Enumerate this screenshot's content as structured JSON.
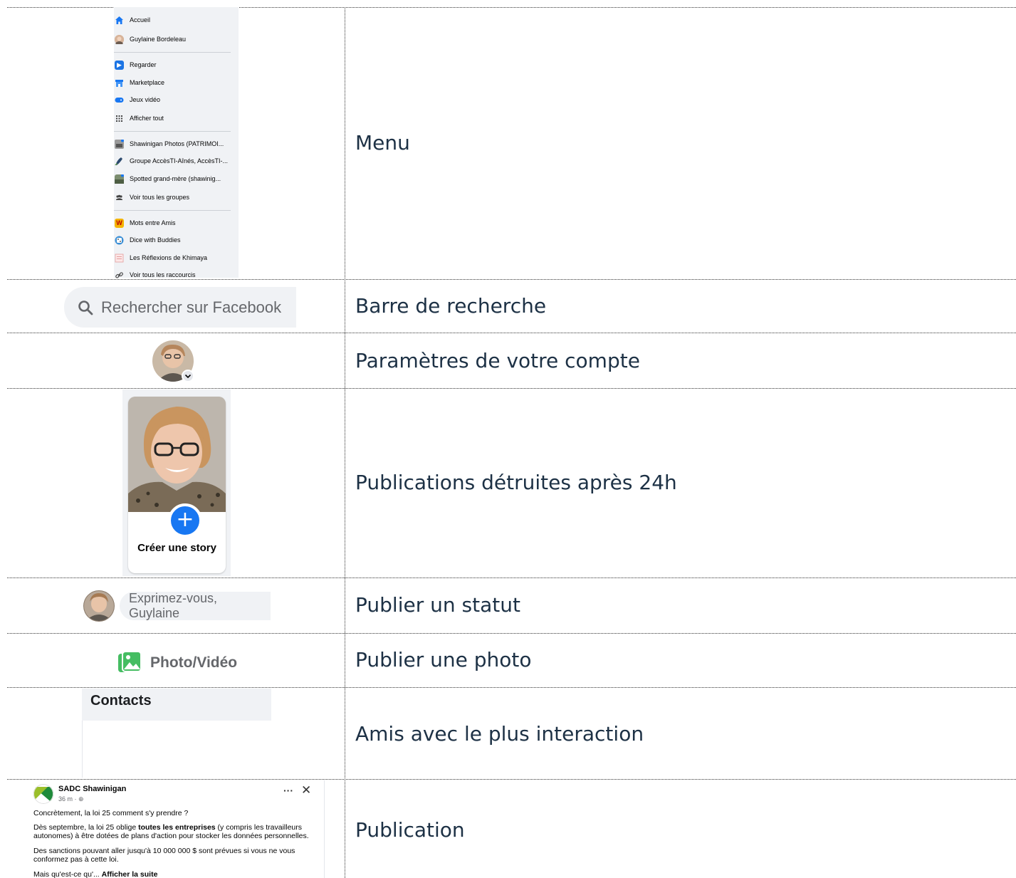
{
  "menu": {
    "items": [
      {
        "label": "Accueil",
        "icon": "home-icon"
      },
      {
        "label": "Guylaine Bordeleau",
        "icon": "profile-avatar"
      },
      {
        "label": "Regarder",
        "icon": "watch-icon"
      },
      {
        "label": "Marketplace",
        "icon": "marketplace-icon"
      },
      {
        "label": "Jeux vidéo",
        "icon": "gaming-icon"
      },
      {
        "label": "Afficher tout",
        "icon": "grid-icon"
      },
      {
        "label": "Shawinigan Photos (PATRIMOI...",
        "icon": "group-icon"
      },
      {
        "label": "Groupe AccèsTI-Aînés, AccèsTI-...",
        "icon": "group-icon"
      },
      {
        "label": "Spotted grand-mère (shawinig...",
        "icon": "group-icon"
      },
      {
        "label": "Voir tous les groupes",
        "icon": "groups-icon"
      },
      {
        "label": "Mots entre Amis",
        "icon": "game-icon"
      },
      {
        "label": "Dice with Buddies",
        "icon": "game-icon"
      },
      {
        "label": "Les Réflexions de Khimaya",
        "icon": "page-icon"
      },
      {
        "label": "Voir tous les raccourcis",
        "icon": "link-icon"
      }
    ]
  },
  "search": {
    "placeholder": "Rechercher sur Facebook"
  },
  "story": {
    "label": "Créer une story"
  },
  "status": {
    "placeholder": "Exprimez-vous, Guylaine"
  },
  "photo": {
    "label": "Photo/Vidéo"
  },
  "contacts": {
    "title": "Contacts"
  },
  "post": {
    "author": "SADC Shawinigan",
    "time": "36 m · ",
    "line1": "Concrètement, la loi 25 comment s'y prendre ?",
    "line2a": "Dès septembre, la loi 25 oblige  ",
    "line2b": "toutes les entreprises",
    "line2c": " (y compris les travailleurs autonomes) à être dotées de plans d'action pour stocker les données personnelles.",
    "line3": "Des sanctions pouvant aller jusqu'à 10 000 000 $ sont prévues si vous ne vous conformez pas à cette loi.",
    "line4a": "Mais qu'est-ce qu'... ",
    "line4b": "Afficher la suite"
  },
  "descriptions": {
    "menu": "Menu",
    "search": "Barre de recherche",
    "account": "Paramètres de votre compte",
    "story": "Publications détruites après 24h",
    "status": "Publier un statut",
    "photo": "Publier une photo",
    "contacts": "Amis avec le plus interaction",
    "post": "Publication"
  }
}
